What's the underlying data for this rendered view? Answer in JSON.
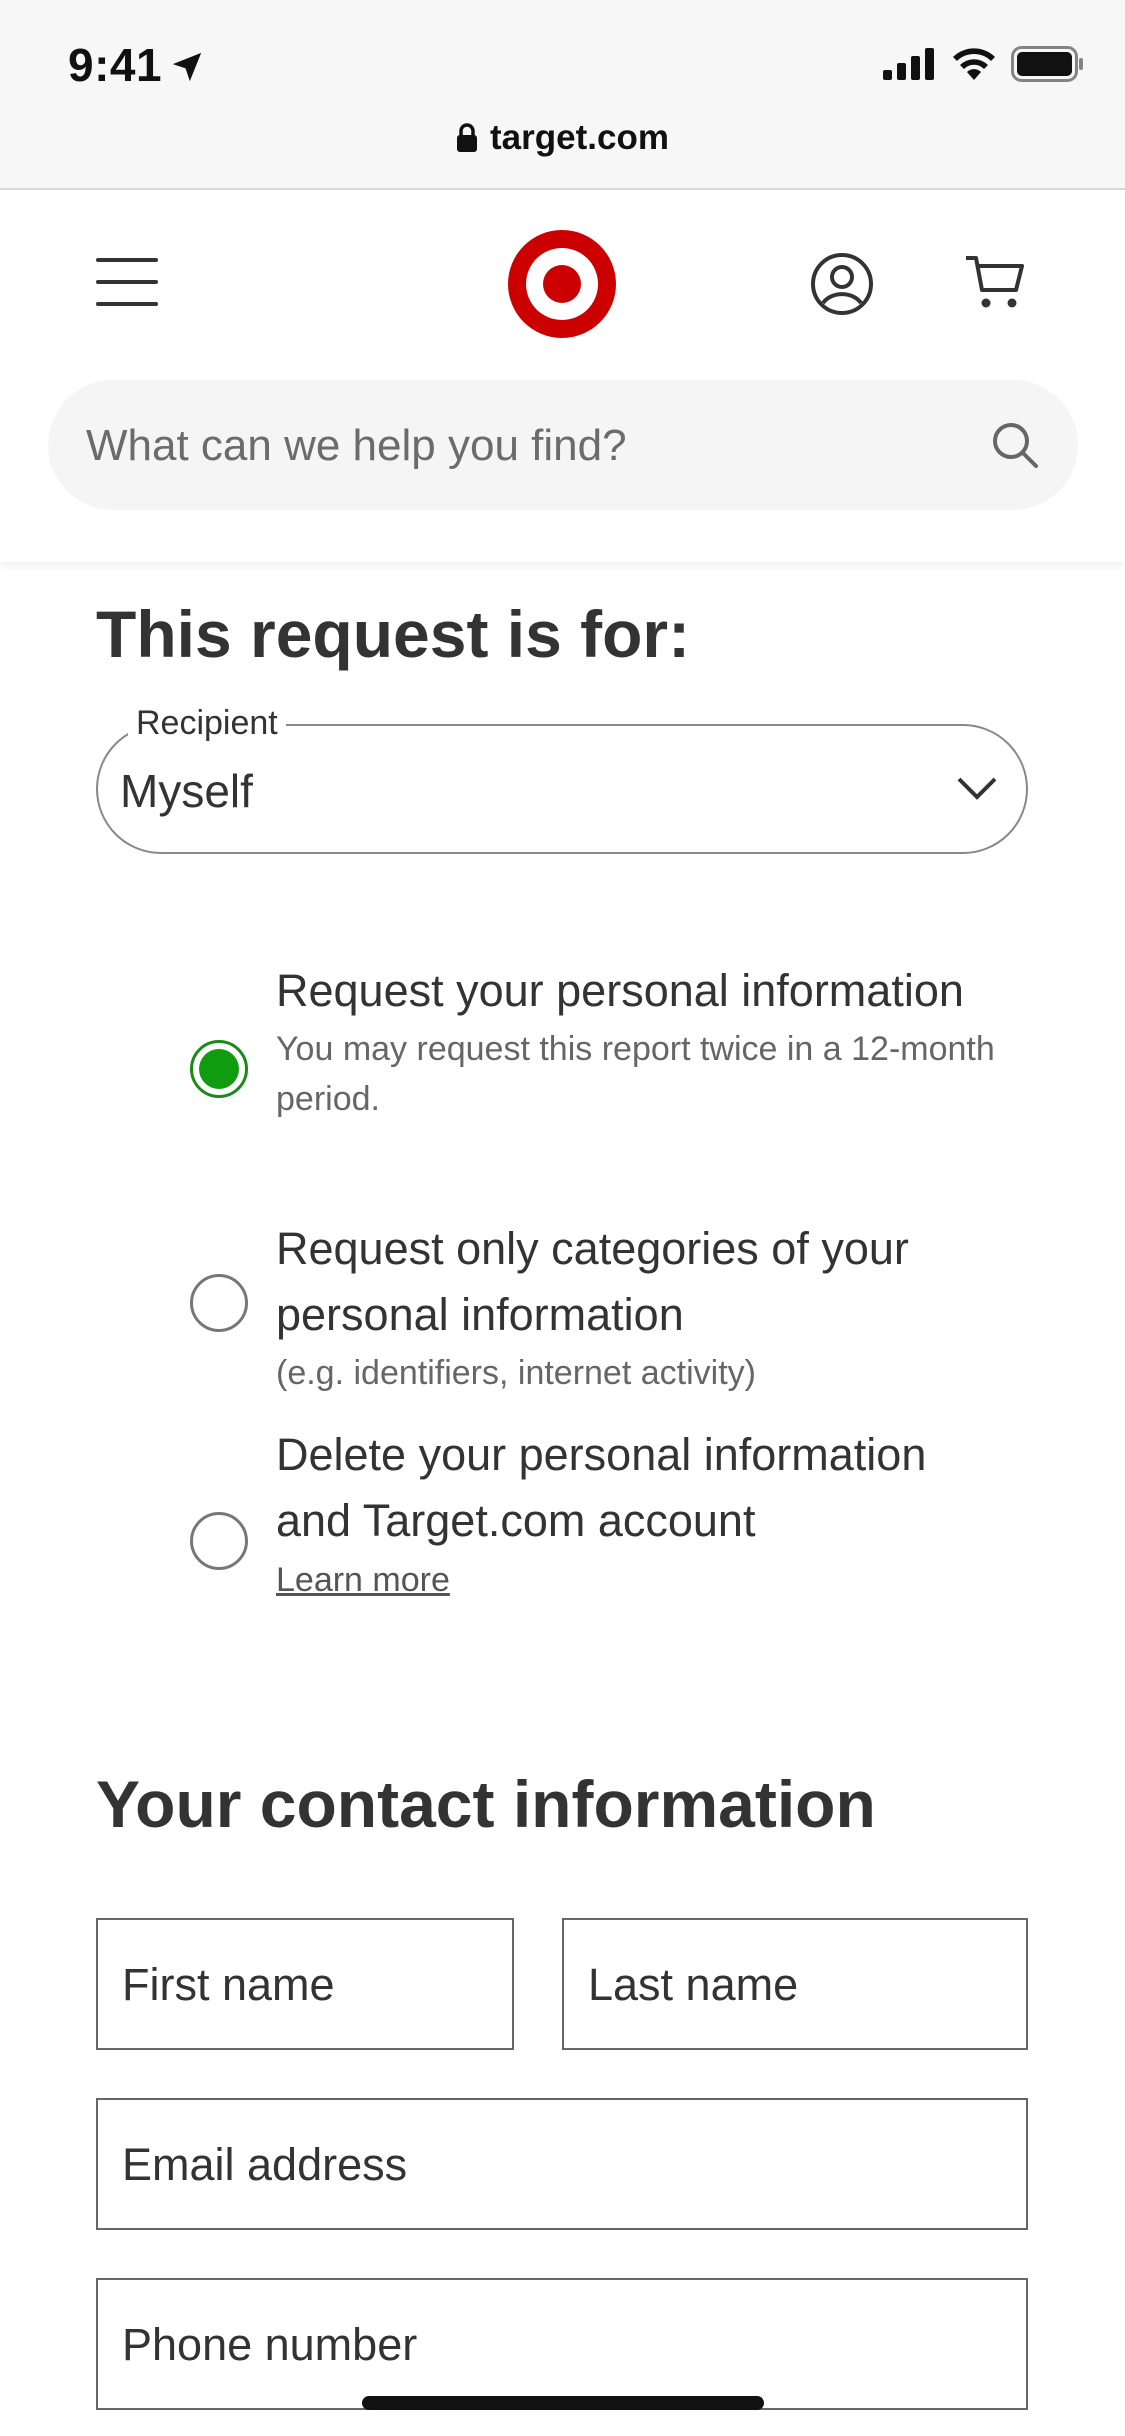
{
  "status_bar": {
    "time": "9:41",
    "url": "target.com"
  },
  "header": {
    "search_placeholder": "What can we help you find?"
  },
  "request_section": {
    "title": "This request is for:",
    "recipient_label": "Recipient",
    "recipient_value": "Myself",
    "options": [
      {
        "title": "Request your personal information",
        "subtitle": "You may request this report twice in a 12-month period.",
        "selected": true
      },
      {
        "title": "Request only categories of your personal information",
        "subtitle": "(e.g. identifiers, internet activity)",
        "selected": false
      },
      {
        "title": "Delete your personal information and Target.com account",
        "link": "Learn more",
        "selected": false
      }
    ]
  },
  "contact_section": {
    "title": "Your contact information",
    "first_name_placeholder": "First name",
    "last_name_placeholder": "Last name",
    "email_placeholder": "Email address",
    "phone_placeholder": "Phone number"
  },
  "colors": {
    "brand_red": "#cc0000",
    "selected_green": "#0f9d0f"
  },
  "icons": [
    "location-arrow-icon",
    "signal-icon",
    "wifi-icon",
    "battery-icon",
    "lock-icon",
    "hamburger-menu-icon",
    "target-logo",
    "account-icon",
    "cart-icon",
    "search-icon",
    "chevron-down-icon"
  ]
}
